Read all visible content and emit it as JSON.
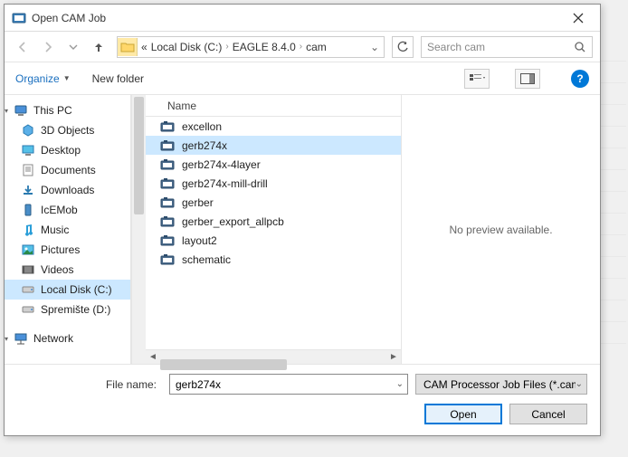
{
  "window": {
    "title": "Open CAM Job"
  },
  "nav": {
    "breadcrumb_prefix": "«",
    "crumbs": [
      "Local Disk (C:)",
      "EAGLE 8.4.0",
      "cam"
    ],
    "search_placeholder": "Search cam"
  },
  "toolbar": {
    "organize": "Organize",
    "new_folder": "New folder"
  },
  "tree": {
    "root": "This PC",
    "items": [
      "3D Objects",
      "Desktop",
      "Documents",
      "Downloads",
      "IcEMob",
      "Music",
      "Pictures",
      "Videos",
      "Local Disk (C:)",
      "Spremište (D:)"
    ],
    "selected": "Local Disk (C:)",
    "network": "Network"
  },
  "list": {
    "col_name": "Name",
    "items": [
      "excellon",
      "gerb274x",
      "gerb274x-4layer",
      "gerb274x-mill-drill",
      "gerber",
      "gerber_export_allpcb",
      "layout2",
      "schematic"
    ],
    "selected": "gerb274x"
  },
  "preview": {
    "text": "No preview available."
  },
  "footer": {
    "filename_label": "File name:",
    "filename_value": "gerb274x",
    "filter_label": "CAM Processor Job Files (*.cam",
    "open": "Open",
    "cancel": "Cancel"
  }
}
